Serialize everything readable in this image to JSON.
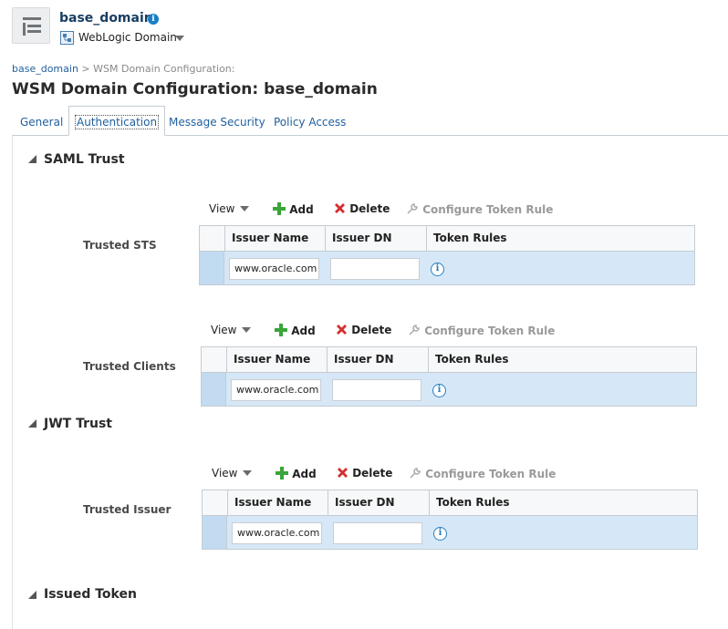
{
  "header": {
    "domain_title": "base_domain",
    "domain_type": "WebLogic Domain"
  },
  "breadcrumb": {
    "link": "base_domain",
    "separator": " > ",
    "current": "WSM Domain Configuration:"
  },
  "page_title": "WSM Domain Configuration: base_domain",
  "tabs": [
    {
      "label": "General"
    },
    {
      "label": "Authentication"
    },
    {
      "label": "Message Security"
    },
    {
      "label": "Policy Access"
    }
  ],
  "toolbar": {
    "view": "View",
    "add": "Add",
    "delete": "Delete",
    "configure": "Configure Token Rule"
  },
  "columns": [
    "Issuer Name",
    "Issuer DN",
    "Token Rules"
  ],
  "sections": {
    "saml": {
      "title": "SAML Trust",
      "sts_label": "Trusted STS",
      "sts_issuer": "www.oracle.com",
      "sts_dn": "",
      "clients_label": "Trusted Clients",
      "clients_issuer": "www.oracle.com",
      "clients_dn": ""
    },
    "jwt": {
      "title": "JWT Trust",
      "issuer_label": "Trusted Issuer",
      "issuer_name": "www.oracle.com",
      "issuer_dn": ""
    },
    "issued": {
      "title": "Issued Token"
    }
  },
  "colors": {
    "link": "#1f5f9e",
    "selected_row": "#d6e8f7",
    "add_icon": "#3aa53a",
    "delete_icon": "#d32f2f"
  }
}
